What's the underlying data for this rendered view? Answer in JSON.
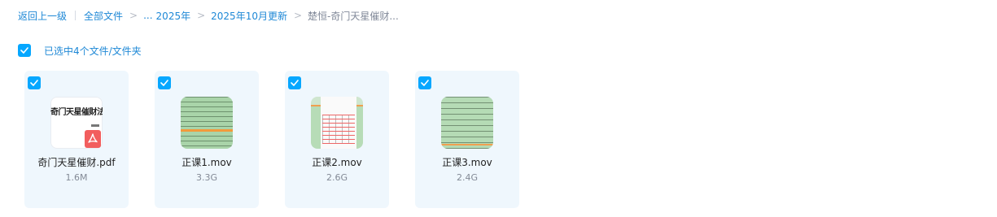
{
  "breadcrumb": {
    "back": "返回上一级",
    "all_files": "全部文件",
    "ellipsis": "...",
    "items": [
      "2025年",
      "2025年10月更新"
    ],
    "current": "楚恒-奇门天星催财..."
  },
  "selection": {
    "label": "已选中4个文件/文件夹"
  },
  "files": [
    {
      "name": "奇门天星催财.pdf",
      "size": "1.6M",
      "thumb_text": "奇门天星催财法"
    },
    {
      "name": "正课1.mov",
      "size": "3.3G"
    },
    {
      "name": "正课2.mov",
      "size": "2.6G"
    },
    {
      "name": "正课3.mov",
      "size": "2.4G"
    }
  ],
  "colors": {
    "accent": "#06a7ff",
    "link": "#1e88d6",
    "card_bg": "#eff7fd",
    "pdf_badge": "#f25e5e"
  },
  "icons": {
    "checkbox": "check-icon",
    "pdf": "pdf-icon",
    "chevron": "chevron-right-icon"
  }
}
